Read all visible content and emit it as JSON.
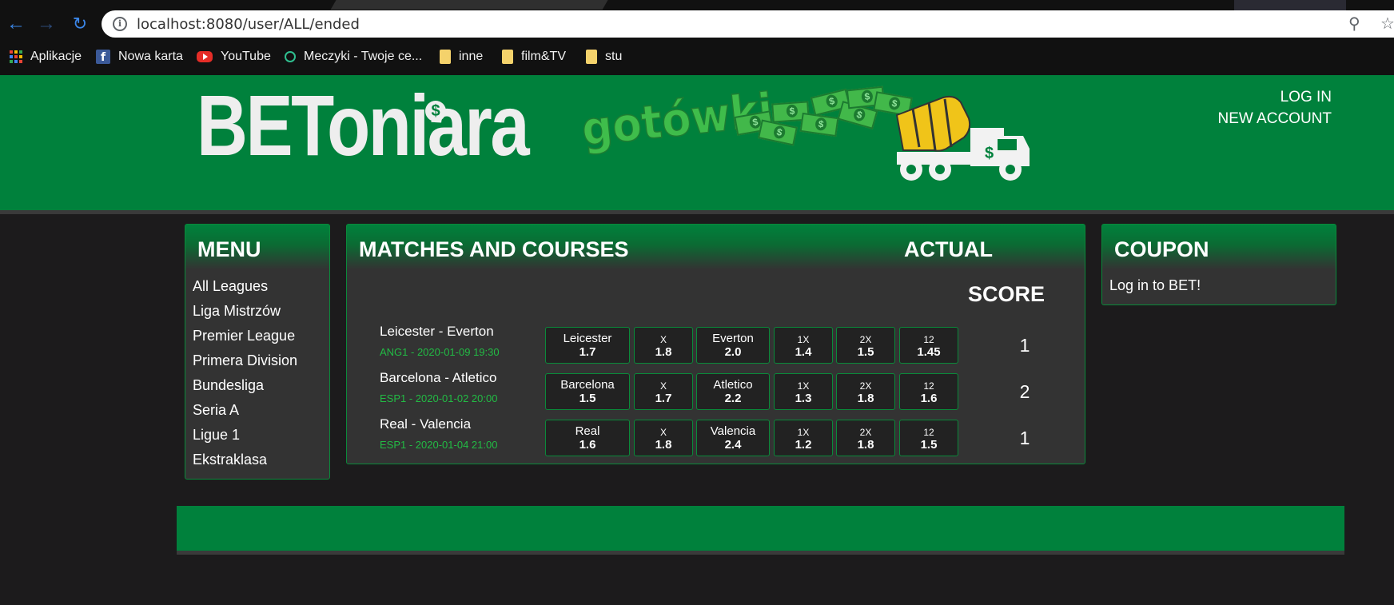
{
  "browser": {
    "url": "localhost:8080/user/ALL/ended",
    "bookmarks": [
      {
        "label": "Aplikacje",
        "icon": "apps-grid-icon"
      },
      {
        "label": "Nowa karta",
        "icon": "facebook-icon"
      },
      {
        "label": "YouTube",
        "icon": "youtube-icon"
      },
      {
        "label": "Meczyki - Twoje ce...",
        "icon": "meczyki-icon"
      },
      {
        "label": "inne",
        "icon": "folder-icon"
      },
      {
        "label": "film&TV",
        "icon": "folder-icon"
      },
      {
        "label": "stu",
        "icon": "folder-icon"
      }
    ]
  },
  "header": {
    "logo": "BEToniara",
    "logo_sub": "gotówki",
    "log_in": "LOG IN",
    "new_account": "NEW ACCOUNT",
    "colors": {
      "brand_green": "#00813c",
      "accent_green": "#22bb44"
    }
  },
  "menu": {
    "title": "MENU",
    "items": [
      "All Leagues",
      "Liga Mistrzów",
      "Premier League",
      "Primera Division",
      "Bundesliga",
      "Seria A",
      "Ligue 1",
      "Ekstraklasa"
    ]
  },
  "matches": {
    "title": "MATCHES AND COURSES",
    "actual": "ACTUAL",
    "score_title": "SCORE",
    "rows": [
      {
        "name": "Leicester - Everton",
        "meta": "ANG1 - 2020-01-09 19:30",
        "odds": [
          {
            "label": "Leicester",
            "value": "1.7"
          },
          {
            "label": "X",
            "value": "1.8"
          },
          {
            "label": "Everton",
            "value": "2.0"
          },
          {
            "label": "1X",
            "value": "1.4"
          },
          {
            "label": "2X",
            "value": "1.5"
          },
          {
            "label": "12",
            "value": "1.45"
          }
        ],
        "score": "1"
      },
      {
        "name": "Barcelona - Atletico",
        "meta": "ESP1 - 2020-01-02 20:00",
        "odds": [
          {
            "label": "Barcelona",
            "value": "1.5"
          },
          {
            "label": "X",
            "value": "1.7"
          },
          {
            "label": "Atletico",
            "value": "2.2"
          },
          {
            "label": "1X",
            "value": "1.3"
          },
          {
            "label": "2X",
            "value": "1.8"
          },
          {
            "label": "12",
            "value": "1.6"
          }
        ],
        "score": "2"
      },
      {
        "name": "Real - Valencia",
        "meta": "ESP1 - 2020-01-04 21:00",
        "odds": [
          {
            "label": "Real",
            "value": "1.6"
          },
          {
            "label": "X",
            "value": "1.8"
          },
          {
            "label": "Valencia",
            "value": "2.4"
          },
          {
            "label": "1X",
            "value": "1.2"
          },
          {
            "label": "2X",
            "value": "1.8"
          },
          {
            "label": "12",
            "value": "1.5"
          }
        ],
        "score": "1"
      }
    ]
  },
  "coupon": {
    "title": "COUPON",
    "message": "Log in to BET!"
  }
}
